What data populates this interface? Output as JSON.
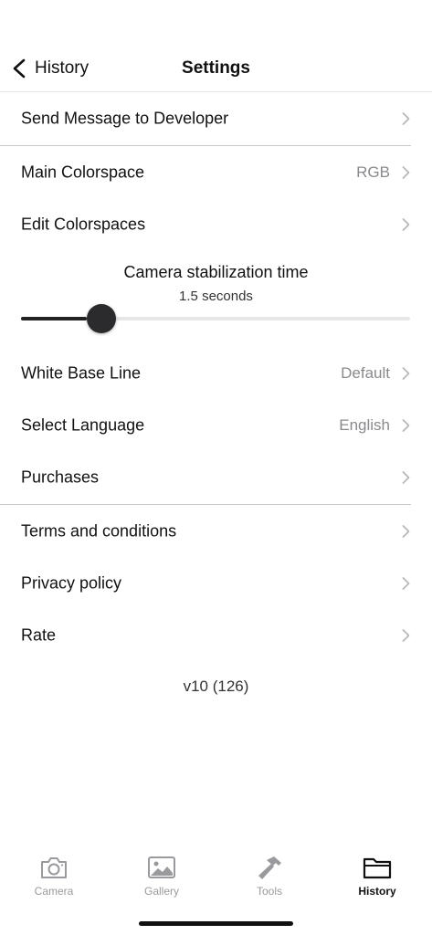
{
  "nav": {
    "back_label": "History",
    "title": "Settings"
  },
  "rows": {
    "send_message": {
      "label": "Send Message to Developer"
    },
    "main_colorspace": {
      "label": "Main Colorspace",
      "value": "RGB"
    },
    "edit_colorspaces": {
      "label": "Edit Colorspaces"
    },
    "white_base_line": {
      "label": "White Base Line",
      "value": "Default"
    },
    "select_language": {
      "label": "Select Language",
      "value": "English"
    },
    "purchases": {
      "label": "Purchases"
    },
    "terms": {
      "label": "Terms and conditions"
    },
    "privacy": {
      "label": "Privacy policy"
    },
    "rate": {
      "label": "Rate"
    }
  },
  "stabilization": {
    "title": "Camera stabilization time",
    "value_text": "1.5 seconds",
    "slider_fraction": 0.17
  },
  "version": "v10 (126)",
  "tabbar": {
    "tabs": [
      {
        "label": "Camera",
        "icon": "camera-icon",
        "active": false
      },
      {
        "label": "Gallery",
        "icon": "gallery-icon",
        "active": false
      },
      {
        "label": "Tools",
        "icon": "hammer-icon",
        "active": false
      },
      {
        "label": "History",
        "icon": "folder-icon",
        "active": true
      }
    ]
  },
  "colors": {
    "text": "#111111",
    "secondary": "#8a8a8e",
    "divider": "#c8c8cc",
    "inactive_tab": "#9a9a9e",
    "slider_thumb": "#2b2b2e"
  }
}
